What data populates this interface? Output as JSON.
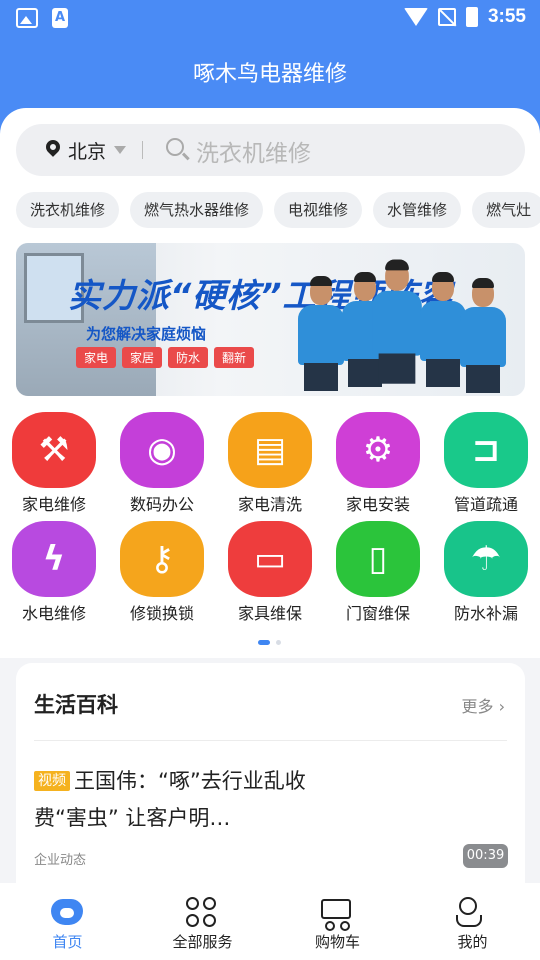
{
  "status_bar": {
    "time": "3:55"
  },
  "header": {
    "title": "啄木鸟电器维修"
  },
  "search": {
    "city": "北京",
    "placeholder": "洗衣机维修"
  },
  "quick_tags": [
    "洗衣机维修",
    "燃气热水器维修",
    "电视维修",
    "水管维修",
    "燃气灶"
  ],
  "banner": {
    "slogan_line1": "实力派“硬核”工程师阵容",
    "slogan_line2": "为您解决家庭烦恼",
    "chips": [
      "家电",
      "家居",
      "防水",
      "翻新"
    ]
  },
  "services": [
    {
      "label": "家电维修",
      "icon": "tools-icon",
      "color": "#ef3b3b",
      "glyph": "⚒"
    },
    {
      "label": "数码办公",
      "icon": "camera-icon",
      "color": "#c43fd9",
      "glyph": "◉"
    },
    {
      "label": "家电清洗",
      "icon": "spray-bottle-icon",
      "color": "#f6a21a",
      "glyph": "▤"
    },
    {
      "label": "家电安装",
      "icon": "drill-icon",
      "color": "#cf3fd6",
      "glyph": "⚙"
    },
    {
      "label": "管道疏通",
      "icon": "pipe-icon",
      "color": "#19c98a",
      "glyph": "⊐"
    },
    {
      "label": "水电维修",
      "icon": "water-bolt-icon",
      "color": "#b84ae0",
      "glyph": "ϟ"
    },
    {
      "label": "修锁换锁",
      "icon": "lock-icon",
      "color": "#f5a51c",
      "glyph": "⚷"
    },
    {
      "label": "家具维保",
      "icon": "sofa-icon",
      "color": "#ee3d3d",
      "glyph": "▭"
    },
    {
      "label": "门窗维保",
      "icon": "door-icon",
      "color": "#2bc43b",
      "glyph": "▯"
    },
    {
      "label": "防水补漏",
      "icon": "umbrella-icon",
      "color": "#18c48a",
      "glyph": "☂"
    }
  ],
  "pager": {
    "pages": 2,
    "current": 1
  },
  "wiki": {
    "title": "生活百科",
    "more": "更多",
    "article": {
      "tag": "视频",
      "title": "王国伟：“啄”去行业乱收费“害虫” 让客户明…",
      "source": "企业动态",
      "duration": "00:39"
    }
  },
  "tabbar": [
    {
      "label": "首页",
      "icon": "home-icon",
      "active": true
    },
    {
      "label": "全部服务",
      "icon": "grid-icon",
      "active": false
    },
    {
      "label": "购物车",
      "icon": "cart-icon",
      "active": false
    },
    {
      "label": "我的",
      "icon": "profile-icon",
      "active": false
    }
  ],
  "colors": {
    "primary": "#4a8bf5",
    "active_tab": "#3f86f2",
    "video_tag": "#f5b21f"
  }
}
